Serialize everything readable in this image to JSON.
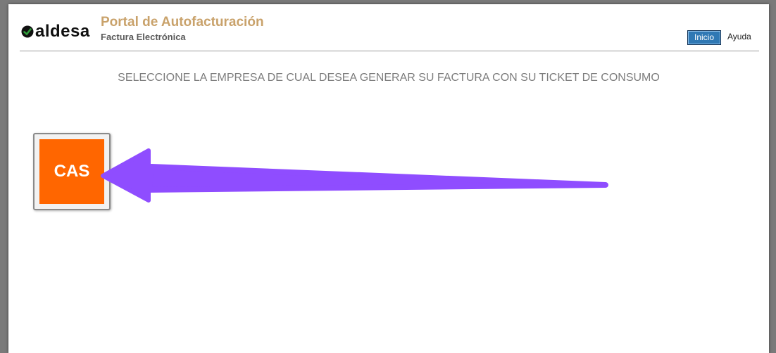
{
  "header": {
    "brand": "aldesa",
    "title": "Portal de Autofacturación",
    "subtitle": "Factura Electrónica"
  },
  "nav": {
    "inicio": "Inicio",
    "ayuda": "Ayuda"
  },
  "main": {
    "instruction": "SELECCIONE LA EMPRESA DE CUAL DESEA GENERAR SU FACTURA CON SU TICKET DE CONSUMO",
    "companies": [
      {
        "label": "CAS"
      }
    ]
  },
  "colors": {
    "title": "#c9a26b",
    "tile": "#ff6600",
    "button": "#2f78b4",
    "arrow": "#8f4dff"
  }
}
